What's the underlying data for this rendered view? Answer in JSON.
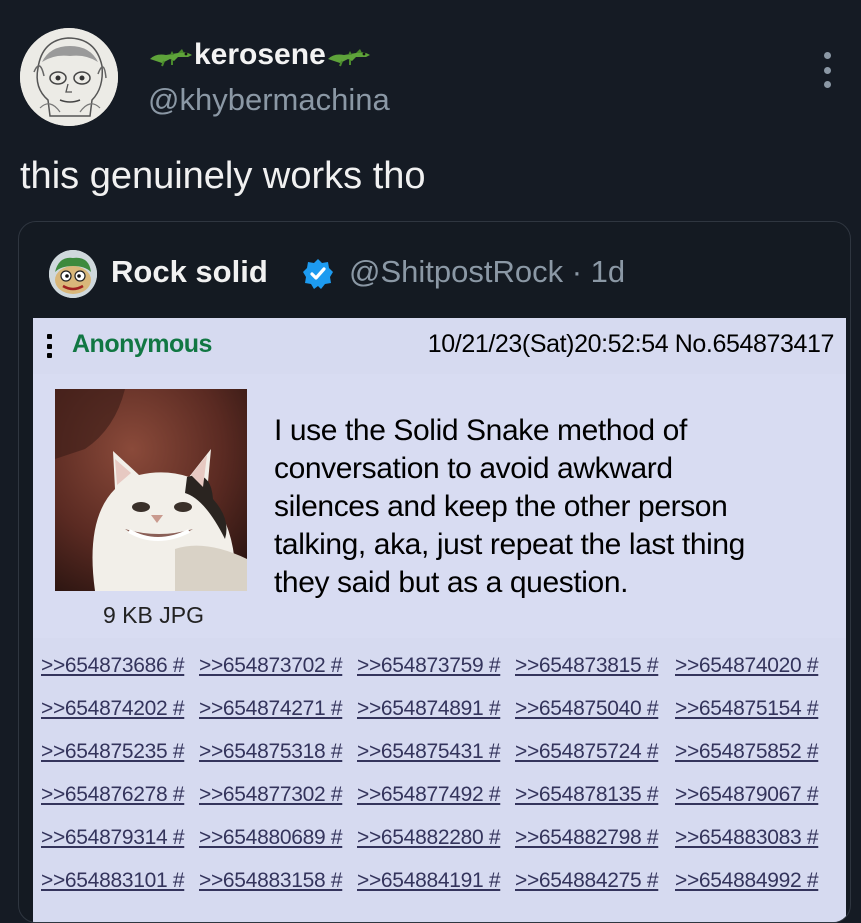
{
  "tweet": {
    "display_name": "kerosene",
    "handle": "@khybermachina",
    "text": "this genuinely works tho"
  },
  "quoted": {
    "display_name": "Rock solid",
    "handle_time": "@ShitpostRock · 1d",
    "verified": true,
    "accent": "#1d9bf0"
  },
  "post": {
    "name": "Anonymous",
    "meta": "10/21/23(Sat)20:52:54 No.654873417",
    "file_info": "9 KB JPG",
    "comment_lines": [
      "I use the Solid Snake method of",
      "conversation to avoid awkward",
      "silences and keep the other person",
      "talking, aka, just repeat the last thing",
      "they said but as a question."
    ],
    "colors": {
      "name": "#117743",
      "background": "#d6daf0",
      "link": "#34345c"
    },
    "replies": [
      [
        ">>654873686 #",
        ">>654873702 #",
        ">>654873759 #",
        ">>654873815 #",
        ">>654874020 #"
      ],
      [
        ">>654874202 #",
        ">>654874271 #",
        ">>654874891 #",
        ">>654875040 #",
        ">>654875154 #"
      ],
      [
        ">>654875235 #",
        ">>654875318 #",
        ">>654875431 #",
        ">>654875724 #",
        ">>654875852 #"
      ],
      [
        ">>654876278 #",
        ">>654877302 #",
        ">>654877492 #",
        ">>654878135 #",
        ">>654879067 #"
      ],
      [
        ">>654879314 #",
        ">>654880689 #",
        ">>654882280 #",
        ">>654882798 #",
        ">>654883083 #"
      ],
      [
        ">>654883101 #",
        ">>654883158 #",
        ">>654884191 #",
        ">>654884275 #",
        ">>654884992 #"
      ]
    ]
  },
  "icons": {
    "avatar": "sketch-portrait-avatar",
    "name_decoration": "crocodile-emoji-icon",
    "more": "more-vertical-icon",
    "quoted_avatar": "cartoon-avatar",
    "verified": "verified-badge-icon",
    "post_menu": "post-menu-icon",
    "thumbnail": "smiling-cat-thumbnail"
  }
}
